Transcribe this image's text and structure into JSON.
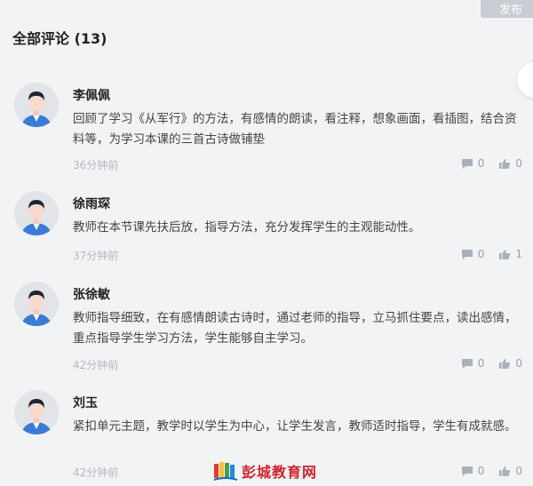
{
  "header": {
    "publish_label": "发布",
    "title": "全部评论 (13)"
  },
  "comments": [
    {
      "name": "李佩佩",
      "content": "回顾了学习《从军行》的方法，有感情的朗读，看注释，想象画面，看插图，结合资料等，为学习本课的三首古诗做铺垫",
      "time": "36分钟前",
      "reply_count": "0",
      "like_count": "0"
    },
    {
      "name": "徐雨琛",
      "content": "教师在本节课先扶后放，指导方法，充分发挥学生的主观能动性。",
      "time": "37分钟前",
      "reply_count": "0",
      "like_count": "1"
    },
    {
      "name": "张徐敏",
      "content": "教师指导细致，在有感情朗读古诗时，通过老师的指导，立马抓住要点，读出感情，重点指导学生学习方法，学生能够自主学习。",
      "time": "42分钟前",
      "reply_count": "0",
      "like_count": "0"
    },
    {
      "name": "刘玉",
      "content": "紧扣单元主题，教学时以学生为中心，让学生发言，教师适时指导，学生有成就感。",
      "time": "42分钟前",
      "reply_count": "0",
      "like_count": "0"
    }
  ],
  "watermark": {
    "text": "彭城教育网"
  },
  "colors": {
    "background": "#f2f3f5",
    "time_text": "#b5b9c0",
    "watermark": "#d0242b"
  }
}
